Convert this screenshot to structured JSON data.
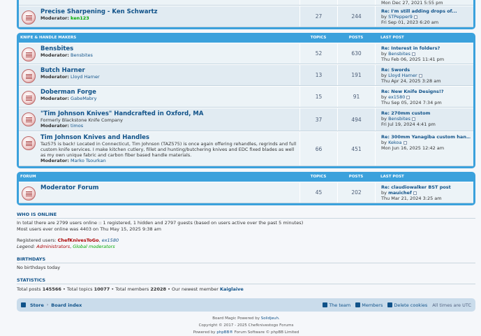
{
  "top_partial": {
    "forum": {
      "title": "Precise Sharpening - Ken Schwartz",
      "moderator_label": "Moderator:",
      "moderator": "ken123",
      "topics": "27",
      "posts": "244",
      "last_title": "Re: I'm still adding drops of...",
      "last_by_label": "by",
      "last_user": "STPepper9",
      "last_date": "Fri Sep 01, 2023 6:20 am"
    },
    "prev_date": "Mon Dec 27, 2021 5:55 pm"
  },
  "sections": [
    {
      "title": "Knife & Handle Makers",
      "col_topics": "Topics",
      "col_posts": "Posts",
      "col_last": "Last post",
      "forums": [
        {
          "title": "Bensbites",
          "desc": "",
          "moderator_label": "Moderator:",
          "moderator": "Bensbites",
          "topics": "52",
          "posts": "630",
          "last_title": "Re: Interest in folders?",
          "last_user": "Bensbites",
          "last_date": "Thu Feb 06, 2025 11:41 pm"
        },
        {
          "title": "Butch Harner",
          "desc": "",
          "moderator_label": "Moderator:",
          "moderator": "Lloyd Harner",
          "topics": "13",
          "posts": "191",
          "last_title": "Re: Swords",
          "last_user": "Lloyd Harner",
          "last_date": "Thu Apr 24, 2025 3:28 am"
        },
        {
          "title": "Doberman Forge",
          "desc": "",
          "moderator_label": "Moderator:",
          "moderator": "GabeMabry",
          "topics": "15",
          "posts": "91",
          "last_title": "Re: New Knife Designs!?",
          "last_user": "ex1580",
          "last_date": "Thu Sep 05, 2024 7:34 pm"
        },
        {
          "title": "\"Tim Johnson Knives\" Handcrafted in Oxford, MA",
          "desc": "Formerly Blackstone Knife Company",
          "moderator_label": "Moderator:",
          "moderator": "timos",
          "topics": "37",
          "posts": "494",
          "last_title": "Re: 270mm custom",
          "last_user": "Bensbites",
          "last_date": "Fri Jul 19, 2024 4:41 pm"
        },
        {
          "title": "Tim Johnson Knives and Handles",
          "desc": "Taz575 is back! Located in Connecticut, Tim Johnson (TAZ575) is once again offering rehandles, regrinds and full custom knife services. I make kitchen cutlery, fillet and hunting/butchering knives and EDC fixed blades as well as my own unique fabric and carbon fiber based handle materials.",
          "moderator_label": "Moderator:",
          "moderator": "Marko Tsourkan",
          "topics": "66",
          "posts": "451",
          "last_title": "Re: 300mm Yanagiba custom han...",
          "last_user": "Kekoa",
          "last_date": "Mon Jun 16, 2025 12:42 am"
        }
      ]
    },
    {
      "title": "Forum",
      "col_topics": "Topics",
      "col_posts": "Posts",
      "col_last": "Last post",
      "forums": [
        {
          "title": "Moderator Forum",
          "desc": "",
          "moderator_label": "",
          "moderator": "",
          "topics": "45",
          "posts": "202",
          "last_title": "Re: claudiowalker BST post",
          "last_user": "mauichef",
          "last_date": "Thu Mar 21, 2024 3:25 am"
        }
      ]
    }
  ],
  "online": {
    "title": "Who is online",
    "line1": "In total there are 2799 users online :: 1 registered, 1 hidden and 2797 guests (based on users active over the past 5 minutes)",
    "line2": "Most users ever online was 4403 on Thu May 15, 2025 9:38 am",
    "registered_label": "Registered users:",
    "user1": "ChefKnivesToGo",
    "sep": ",",
    "user2": "ex1580",
    "legend_label": "Legend:",
    "legend_admin": "Administrators",
    "legend_gmod": "Global moderators"
  },
  "birthdays": {
    "title": "Birthdays",
    "text": "No birthdays today"
  },
  "statistics": {
    "title": "Statistics",
    "posts_label": "Total posts",
    "posts": "145566",
    "topics_label": "• Total topics",
    "topics": "10077",
    "members_label": "• Total members",
    "members": "22028",
    "newest_label": "• Our newest member",
    "newest": "Kaiglaive"
  },
  "navbar": {
    "store": "Store",
    "board_index": "Board index",
    "team": "The team",
    "members": "Members",
    "delete_cookies": "Delete cookies",
    "times": "All times are UTC"
  },
  "footer": {
    "line1_pre": "Board Magic Powered by",
    "line1_link": "Solidjeuh.",
    "line2": "Copyright © 2017 - 2025 Chefknivestogo Forums",
    "line3_pre": "Powered by",
    "line3_link": "phpBB®",
    "line3_post": "Forum Software © phpBB Limited"
  }
}
